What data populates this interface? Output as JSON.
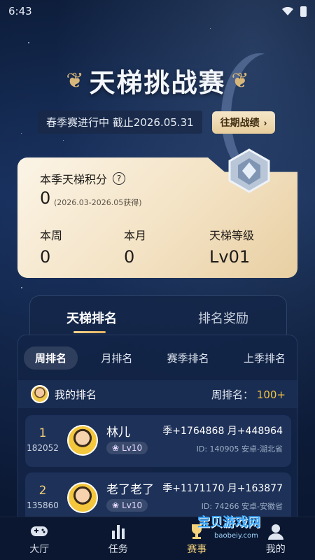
{
  "status_bar": {
    "time": "6:43"
  },
  "header": {
    "title": "天梯挑战赛",
    "season_text": "春季赛进行中 截止2026.05.31",
    "past_button": "往期战绩"
  },
  "score_card": {
    "label": "本季天梯积分",
    "value": "0",
    "range": "(2026.03-2026.05获得)",
    "week_label": "本周",
    "week_value": "0",
    "month_label": "本月",
    "month_value": "0",
    "level_label": "天梯等级",
    "level_value": "Lv01"
  },
  "main_tabs": {
    "active": "天梯排名",
    "inactive": "排名奖励"
  },
  "sub_tabs": [
    "周排名",
    "月排名",
    "赛季排名",
    "上季排名"
  ],
  "my_rank": {
    "label": "我的排名",
    "week_label": "周排名：",
    "week_value": "100+"
  },
  "entries": [
    {
      "rank": "1",
      "points": "182052",
      "name": "林儿",
      "level": "Lv10",
      "stats": "季+1764868 月+448964",
      "meta": "ID: 140905 安卓-湖北省"
    },
    {
      "rank": "2",
      "points": "135860",
      "name": "老了老了",
      "level": "Lv10",
      "stats": "季+1171170 月+163877",
      "meta": "ID: 74266 安卓-安徽省"
    }
  ],
  "bottom_nav": [
    "大厅",
    "任务",
    "赛事",
    "我的"
  ],
  "watermark": {
    "title": "宝贝游戏网",
    "url": "baobeiy.com"
  },
  "colors": {
    "accent_gold": "#f3d27b",
    "card_bg": "#f4e4c7",
    "highlight": "#f4c542"
  }
}
